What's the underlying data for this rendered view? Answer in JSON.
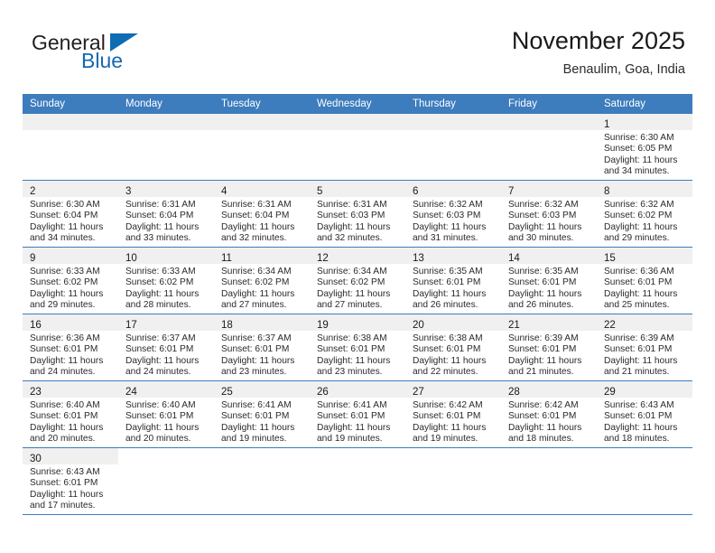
{
  "brand": {
    "name_part1": "General",
    "name_part2": "Blue",
    "accent_color": "#0d6cb4"
  },
  "header": {
    "month_title": "November 2025",
    "location": "Benaulim, Goa, India"
  },
  "calendar": {
    "header_bg": "#3d7cbd",
    "weekday_headers": [
      "Sunday",
      "Monday",
      "Tuesday",
      "Wednesday",
      "Thursday",
      "Friday",
      "Saturday"
    ],
    "weeks": [
      [
        {
          "day": "",
          "blank": true
        },
        {
          "day": "",
          "blank": true
        },
        {
          "day": "",
          "blank": true
        },
        {
          "day": "",
          "blank": true
        },
        {
          "day": "",
          "blank": true
        },
        {
          "day": "",
          "blank": true
        },
        {
          "day": "1",
          "sunrise": "Sunrise: 6:30 AM",
          "sunset": "Sunset: 6:05 PM",
          "daylight_line1": "Daylight: 11 hours",
          "daylight_line2": "and 34 minutes."
        }
      ],
      [
        {
          "day": "2",
          "sunrise": "Sunrise: 6:30 AM",
          "sunset": "Sunset: 6:04 PM",
          "daylight_line1": "Daylight: 11 hours",
          "daylight_line2": "and 34 minutes."
        },
        {
          "day": "3",
          "sunrise": "Sunrise: 6:31 AM",
          "sunset": "Sunset: 6:04 PM",
          "daylight_line1": "Daylight: 11 hours",
          "daylight_line2": "and 33 minutes."
        },
        {
          "day": "4",
          "sunrise": "Sunrise: 6:31 AM",
          "sunset": "Sunset: 6:04 PM",
          "daylight_line1": "Daylight: 11 hours",
          "daylight_line2": "and 32 minutes."
        },
        {
          "day": "5",
          "sunrise": "Sunrise: 6:31 AM",
          "sunset": "Sunset: 6:03 PM",
          "daylight_line1": "Daylight: 11 hours",
          "daylight_line2": "and 32 minutes."
        },
        {
          "day": "6",
          "sunrise": "Sunrise: 6:32 AM",
          "sunset": "Sunset: 6:03 PM",
          "daylight_line1": "Daylight: 11 hours",
          "daylight_line2": "and 31 minutes."
        },
        {
          "day": "7",
          "sunrise": "Sunrise: 6:32 AM",
          "sunset": "Sunset: 6:03 PM",
          "daylight_line1": "Daylight: 11 hours",
          "daylight_line2": "and 30 minutes."
        },
        {
          "day": "8",
          "sunrise": "Sunrise: 6:32 AM",
          "sunset": "Sunset: 6:02 PM",
          "daylight_line1": "Daylight: 11 hours",
          "daylight_line2": "and 29 minutes."
        }
      ],
      [
        {
          "day": "9",
          "sunrise": "Sunrise: 6:33 AM",
          "sunset": "Sunset: 6:02 PM",
          "daylight_line1": "Daylight: 11 hours",
          "daylight_line2": "and 29 minutes."
        },
        {
          "day": "10",
          "sunrise": "Sunrise: 6:33 AM",
          "sunset": "Sunset: 6:02 PM",
          "daylight_line1": "Daylight: 11 hours",
          "daylight_line2": "and 28 minutes."
        },
        {
          "day": "11",
          "sunrise": "Sunrise: 6:34 AM",
          "sunset": "Sunset: 6:02 PM",
          "daylight_line1": "Daylight: 11 hours",
          "daylight_line2": "and 27 minutes."
        },
        {
          "day": "12",
          "sunrise": "Sunrise: 6:34 AM",
          "sunset": "Sunset: 6:02 PM",
          "daylight_line1": "Daylight: 11 hours",
          "daylight_line2": "and 27 minutes."
        },
        {
          "day": "13",
          "sunrise": "Sunrise: 6:35 AM",
          "sunset": "Sunset: 6:01 PM",
          "daylight_line1": "Daylight: 11 hours",
          "daylight_line2": "and 26 minutes."
        },
        {
          "day": "14",
          "sunrise": "Sunrise: 6:35 AM",
          "sunset": "Sunset: 6:01 PM",
          "daylight_line1": "Daylight: 11 hours",
          "daylight_line2": "and 26 minutes."
        },
        {
          "day": "15",
          "sunrise": "Sunrise: 6:36 AM",
          "sunset": "Sunset: 6:01 PM",
          "daylight_line1": "Daylight: 11 hours",
          "daylight_line2": "and 25 minutes."
        }
      ],
      [
        {
          "day": "16",
          "sunrise": "Sunrise: 6:36 AM",
          "sunset": "Sunset: 6:01 PM",
          "daylight_line1": "Daylight: 11 hours",
          "daylight_line2": "and 24 minutes."
        },
        {
          "day": "17",
          "sunrise": "Sunrise: 6:37 AM",
          "sunset": "Sunset: 6:01 PM",
          "daylight_line1": "Daylight: 11 hours",
          "daylight_line2": "and 24 minutes."
        },
        {
          "day": "18",
          "sunrise": "Sunrise: 6:37 AM",
          "sunset": "Sunset: 6:01 PM",
          "daylight_line1": "Daylight: 11 hours",
          "daylight_line2": "and 23 minutes."
        },
        {
          "day": "19",
          "sunrise": "Sunrise: 6:38 AM",
          "sunset": "Sunset: 6:01 PM",
          "daylight_line1": "Daylight: 11 hours",
          "daylight_line2": "and 23 minutes."
        },
        {
          "day": "20",
          "sunrise": "Sunrise: 6:38 AM",
          "sunset": "Sunset: 6:01 PM",
          "daylight_line1": "Daylight: 11 hours",
          "daylight_line2": "and 22 minutes."
        },
        {
          "day": "21",
          "sunrise": "Sunrise: 6:39 AM",
          "sunset": "Sunset: 6:01 PM",
          "daylight_line1": "Daylight: 11 hours",
          "daylight_line2": "and 21 minutes."
        },
        {
          "day": "22",
          "sunrise": "Sunrise: 6:39 AM",
          "sunset": "Sunset: 6:01 PM",
          "daylight_line1": "Daylight: 11 hours",
          "daylight_line2": "and 21 minutes."
        }
      ],
      [
        {
          "day": "23",
          "sunrise": "Sunrise: 6:40 AM",
          "sunset": "Sunset: 6:01 PM",
          "daylight_line1": "Daylight: 11 hours",
          "daylight_line2": "and 20 minutes."
        },
        {
          "day": "24",
          "sunrise": "Sunrise: 6:40 AM",
          "sunset": "Sunset: 6:01 PM",
          "daylight_line1": "Daylight: 11 hours",
          "daylight_line2": "and 20 minutes."
        },
        {
          "day": "25",
          "sunrise": "Sunrise: 6:41 AM",
          "sunset": "Sunset: 6:01 PM",
          "daylight_line1": "Daylight: 11 hours",
          "daylight_line2": "and 19 minutes."
        },
        {
          "day": "26",
          "sunrise": "Sunrise: 6:41 AM",
          "sunset": "Sunset: 6:01 PM",
          "daylight_line1": "Daylight: 11 hours",
          "daylight_line2": "and 19 minutes."
        },
        {
          "day": "27",
          "sunrise": "Sunrise: 6:42 AM",
          "sunset": "Sunset: 6:01 PM",
          "daylight_line1": "Daylight: 11 hours",
          "daylight_line2": "and 19 minutes."
        },
        {
          "day": "28",
          "sunrise": "Sunrise: 6:42 AM",
          "sunset": "Sunset: 6:01 PM",
          "daylight_line1": "Daylight: 11 hours",
          "daylight_line2": "and 18 minutes."
        },
        {
          "day": "29",
          "sunrise": "Sunrise: 6:43 AM",
          "sunset": "Sunset: 6:01 PM",
          "daylight_line1": "Daylight: 11 hours",
          "daylight_line2": "and 18 minutes."
        }
      ],
      [
        {
          "day": "30",
          "sunrise": "Sunrise: 6:43 AM",
          "sunset": "Sunset: 6:01 PM",
          "daylight_line1": "Daylight: 11 hours",
          "daylight_line2": "and 17 minutes."
        },
        {
          "day": "",
          "blank": true,
          "empty": true
        },
        {
          "day": "",
          "blank": true,
          "empty": true
        },
        {
          "day": "",
          "blank": true,
          "empty": true
        },
        {
          "day": "",
          "blank": true,
          "empty": true
        },
        {
          "day": "",
          "blank": true,
          "empty": true
        },
        {
          "day": "",
          "blank": true,
          "empty": true
        }
      ]
    ]
  }
}
